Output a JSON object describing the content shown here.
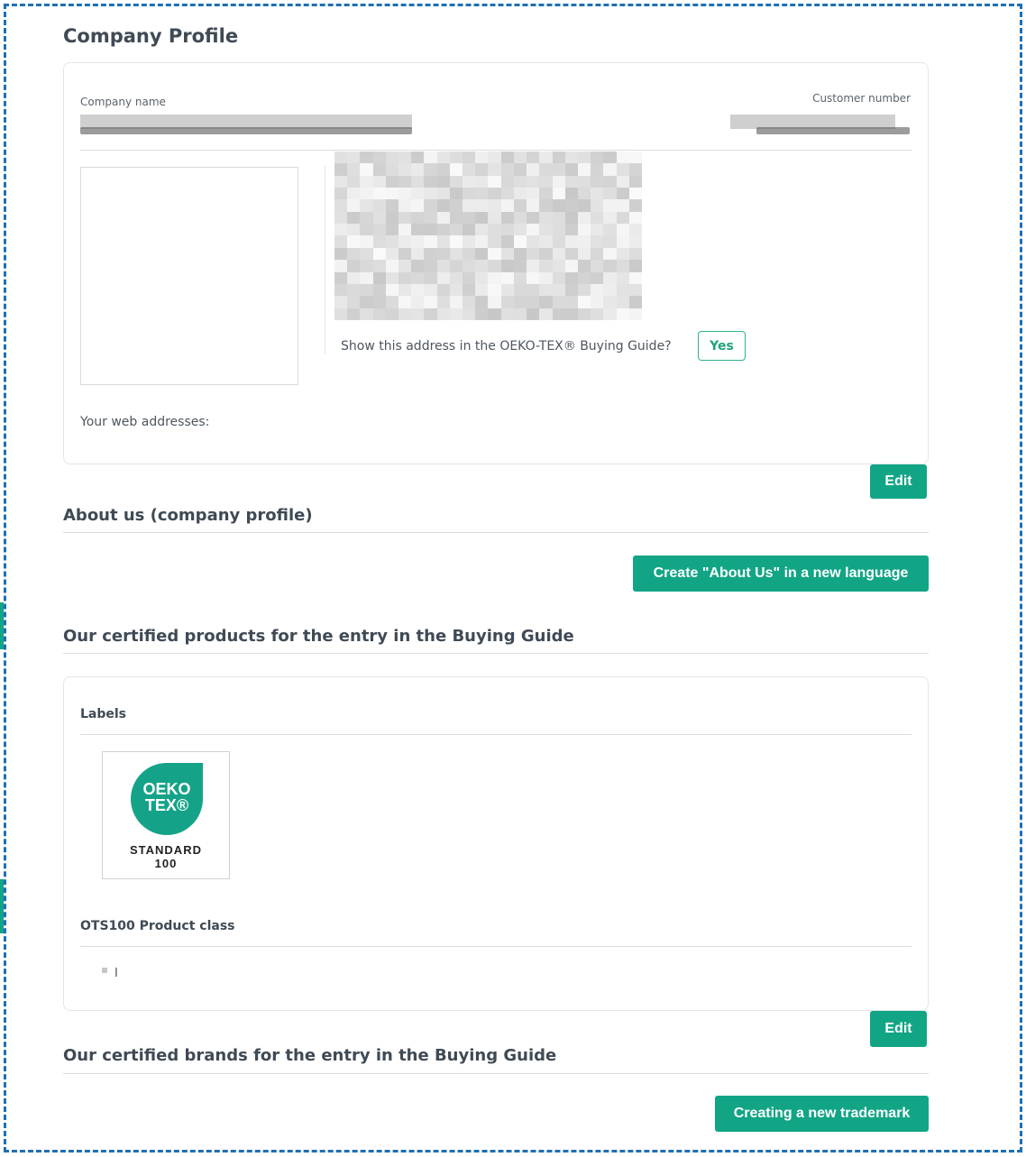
{
  "page": {
    "title": "Company Profile"
  },
  "company": {
    "name_label": "Company name",
    "customer_number_label": "Customer number",
    "buying_guide_question": "Show this address in the OEKO-TEX® Buying Guide?",
    "buying_guide_value": "Yes",
    "web_addresses_label": "Your web addresses:",
    "edit_label": "Edit"
  },
  "about": {
    "title": "About us (company profile)",
    "create_button": "Create \"About Us\" in a new language"
  },
  "products": {
    "title": "Our certified products for the entry in the Buying Guide",
    "labels_heading": "Labels",
    "label_logo": {
      "line1": "OEKO",
      "line2": "TEX®",
      "line3": "STANDARD",
      "line4": "100"
    },
    "product_class_heading": "OTS100 Product class",
    "product_class_items": [
      "I"
    ],
    "edit_label": "Edit"
  },
  "brands": {
    "title": "Our certified brands for the entry in the Buying Guide",
    "create_button": "Creating a new trademark"
  },
  "colors": {
    "accent": "#12a585",
    "frame_border": "#1f6fb3",
    "card_border": "#e3e6e8"
  }
}
